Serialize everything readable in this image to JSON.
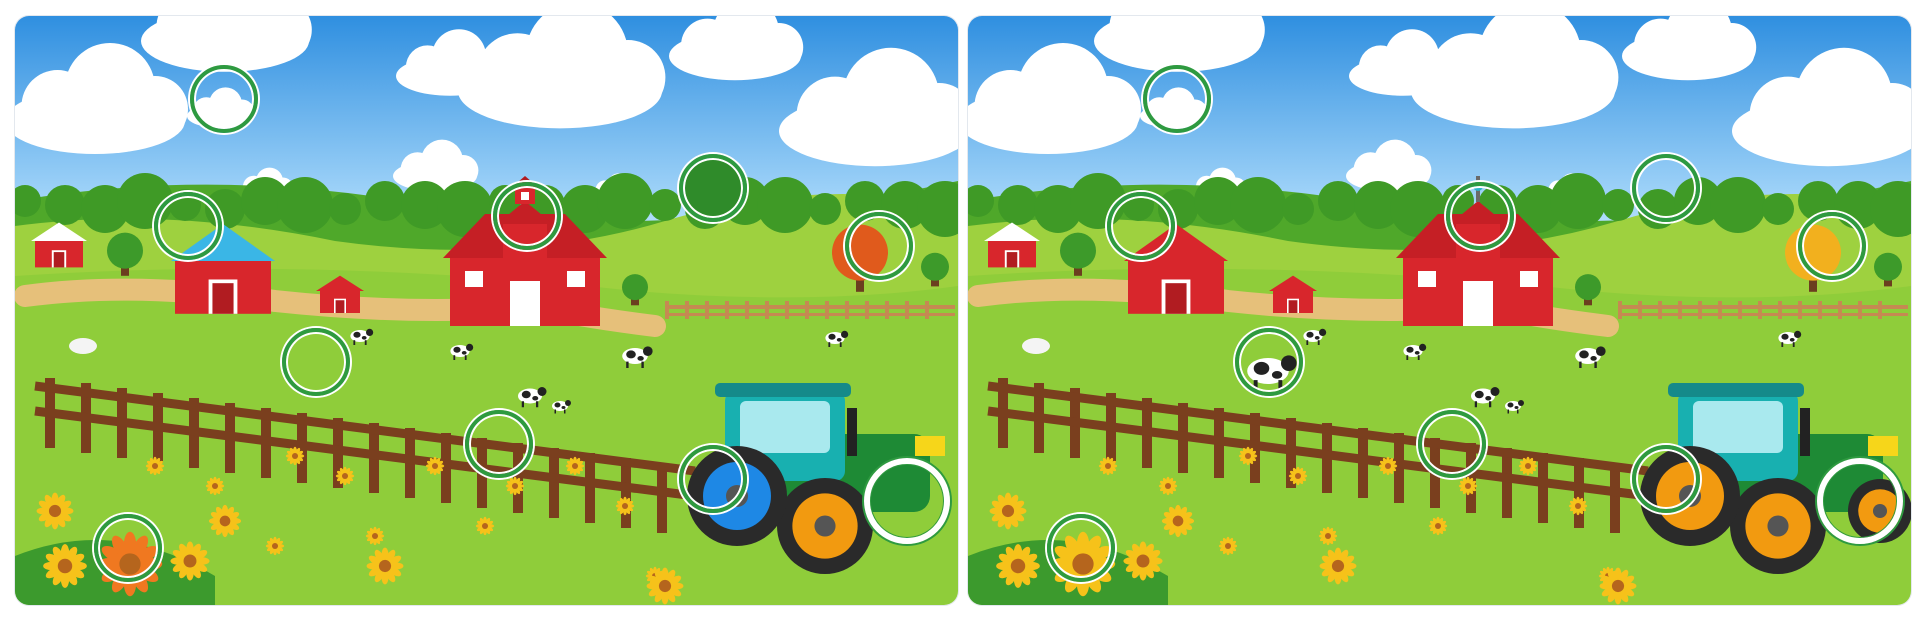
{
  "game": {
    "type": "spot-the-difference",
    "differences_found": 10,
    "colors": {
      "found_marker": "#2e9a40",
      "current_marker": "#ffffff",
      "sky": "#2f8fe0",
      "grass": "#8fcd3a",
      "barn": "#d8262c",
      "fence": "#7a3f1e",
      "tractor_body": "#1e8a35",
      "tractor_cab": "#18b0b0"
    }
  },
  "panels": [
    {
      "name": "left-picture",
      "variants": {
        "small_barn_roof": "#3ab6e6",
        "barn_top": "red-cupola",
        "treetop_right": "green-tree",
        "tree_far_right": "#e05a1c",
        "cow_middle": "absent",
        "tractor_front_wheel": "#1e88e5",
        "tractor_rear_wheel": "absent",
        "flower_bottom": "#f07820",
        "cloud_small": "present"
      }
    },
    {
      "name": "right-picture",
      "variants": {
        "small_barn_roof": "#d8262c",
        "barn_top": "weathervane",
        "treetop_right": "absent",
        "tree_far_right": "#f2b01e",
        "cow_middle": "present",
        "tractor_front_wheel": "#f29a10",
        "tractor_rear_wheel": "present",
        "flower_bottom": "#f6c21a",
        "cloud_small": "present"
      }
    }
  ],
  "markers": [
    {
      "name": "difference-cloud"
    },
    {
      "name": "difference-small-barn-roof"
    },
    {
      "name": "difference-barn-top"
    },
    {
      "name": "difference-treetop"
    },
    {
      "name": "difference-tree-color"
    },
    {
      "name": "difference-cow"
    },
    {
      "name": "difference-fence"
    },
    {
      "name": "difference-tractor-wheel"
    },
    {
      "name": "difference-flower"
    },
    {
      "name": "difference-rear-wheel",
      "current": true
    }
  ]
}
